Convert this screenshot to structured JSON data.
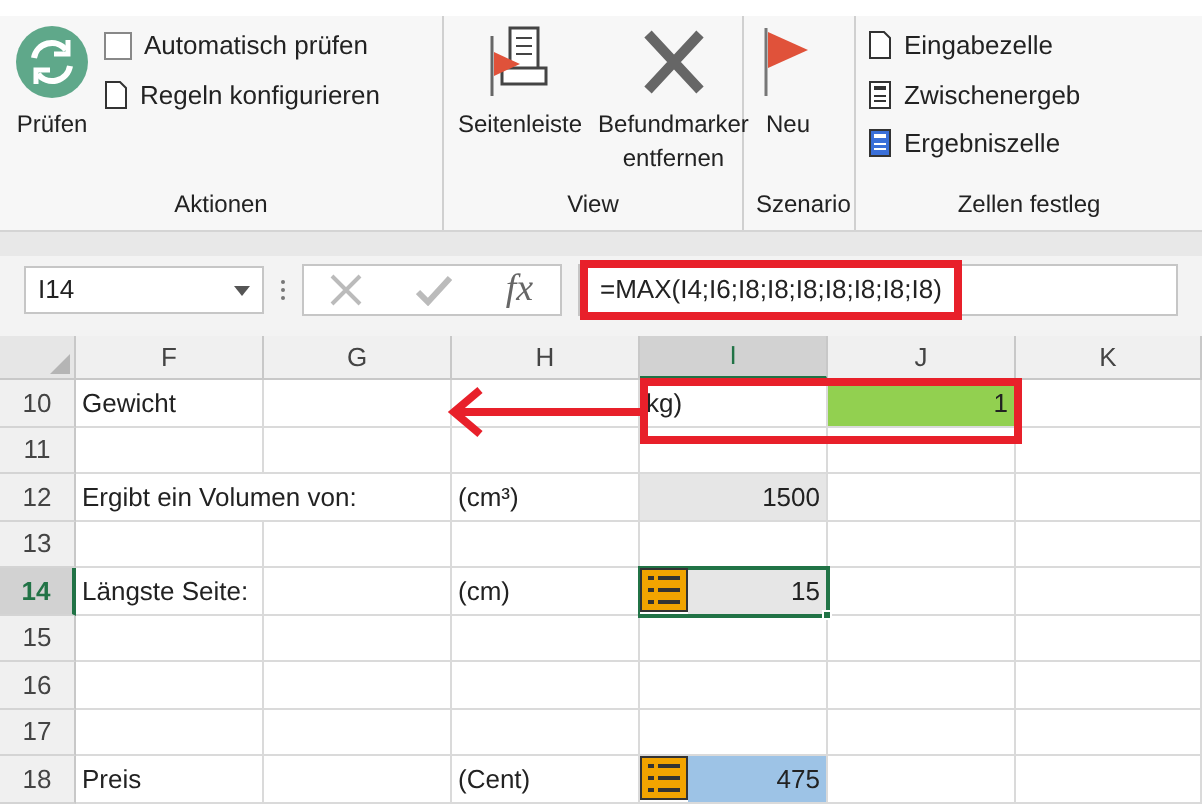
{
  "ribbon": {
    "groups": [
      {
        "label": "Aktionen",
        "items": [
          {
            "kind": "big",
            "label": "Prüfen"
          },
          {
            "kind": "checkbox",
            "label": "Automatisch prüfen",
            "checked": false
          },
          {
            "kind": "small",
            "label": "Regeln konfigurieren"
          }
        ]
      },
      {
        "label": "View",
        "items": [
          {
            "kind": "big",
            "label": "Seitenleiste"
          },
          {
            "kind": "big",
            "label": "Befundmarker entfernen"
          }
        ]
      },
      {
        "label": "Szenario",
        "items": [
          {
            "kind": "big",
            "label": "Neu"
          }
        ]
      },
      {
        "label": "Zellen festleg",
        "items": [
          {
            "kind": "small",
            "label": "Eingabezelle"
          },
          {
            "kind": "small",
            "label": "Zwischenergeb"
          },
          {
            "kind": "small",
            "label": "Ergebniszelle"
          }
        ]
      }
    ]
  },
  "formula_bar": {
    "name_box": "I14",
    "fx": "fx",
    "formula": "=MAX(I4;I6;I8;I8;I8;I8;I8;I8;I8)"
  },
  "columns": [
    {
      "label": "F",
      "selected": false
    },
    {
      "label": "G",
      "selected": false
    },
    {
      "label": "H",
      "selected": false
    },
    {
      "label": "I",
      "selected": true
    },
    {
      "label": "J",
      "selected": false
    },
    {
      "label": "K",
      "selected": false
    }
  ],
  "rows": [
    {
      "number": "10",
      "selected": false,
      "cells": [
        {
          "text": "Gewicht",
          "kind": "text"
        },
        {},
        {},
        {
          "text": "kg)",
          "kind": "text"
        },
        {
          "text": "1",
          "kind": "number",
          "color": "#92d050"
        },
        {}
      ]
    },
    {
      "number": "11",
      "selected": false,
      "cells": [
        {},
        {},
        {},
        {},
        {},
        {}
      ]
    },
    {
      "number": "12",
      "selected": false,
      "cells": [
        {
          "text": "Ergibt ein Volumen von:",
          "kind": "text"
        },
        {},
        {
          "text": "(cm³)",
          "kind": "text"
        },
        {
          "text": "1500",
          "kind": "number",
          "color": "#e6e6e6"
        },
        {},
        {}
      ]
    },
    {
      "number": "13",
      "selected": false,
      "cells": [
        {},
        {},
        {},
        {},
        {},
        {}
      ]
    },
    {
      "number": "14",
      "selected": true,
      "cells": [
        {
          "text": "Längste Seite:",
          "kind": "text"
        },
        {},
        {
          "text": "(cm)",
          "kind": "text"
        },
        {
          "text": "15",
          "kind": "number",
          "color": "#e6e6e6",
          "marker": true,
          "selected": true
        },
        {},
        {}
      ]
    },
    {
      "number": "15",
      "selected": false,
      "cells": [
        {},
        {},
        {},
        {},
        {},
        {}
      ]
    },
    {
      "number": "16",
      "selected": false,
      "cells": [
        {},
        {},
        {},
        {},
        {},
        {}
      ]
    },
    {
      "number": "17",
      "selected": false,
      "cells": [
        {},
        {},
        {},
        {},
        {},
        {}
      ]
    },
    {
      "number": "18",
      "selected": false,
      "cells": [
        {
          "text": "Preis",
          "kind": "text"
        },
        {},
        {
          "text": "(Cent)",
          "kind": "text"
        },
        {
          "text": "475",
          "kind": "number",
          "color": "#9dc3e6",
          "marker": true
        },
        {},
        {}
      ]
    }
  ]
}
